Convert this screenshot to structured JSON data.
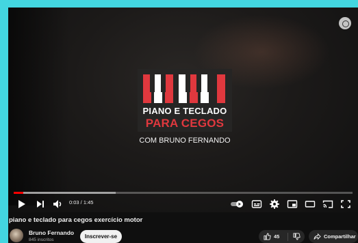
{
  "video": {
    "logo_line1": "PIANO E TECLADO",
    "logo_line2": "PARA CEGOS",
    "logo_subtitle": "COM BRUNO FERNANDO",
    "brand_colors": {
      "accent_red": "#e0383e",
      "progress_red": "#ff0000"
    }
  },
  "player": {
    "time_display": "0:03 / 1:45",
    "progress_fraction": 0.029,
    "buffered_fraction": 0.3,
    "autoplay_on": true,
    "icons": [
      "play-icon",
      "next-icon",
      "volume-icon",
      "autoplay-toggle",
      "subtitles-icon",
      "settings-icon",
      "miniplayer-icon",
      "theater-icon",
      "cast-icon",
      "fullscreen-icon"
    ]
  },
  "meta": {
    "title": "piano e teclado para cegos exercício motor",
    "channel_name": "Bruno Fernando",
    "subscribers": "845 inscritos",
    "subscribe_label": "Inscrever-se",
    "like_count": "45",
    "share_label": "Compartilhar"
  }
}
